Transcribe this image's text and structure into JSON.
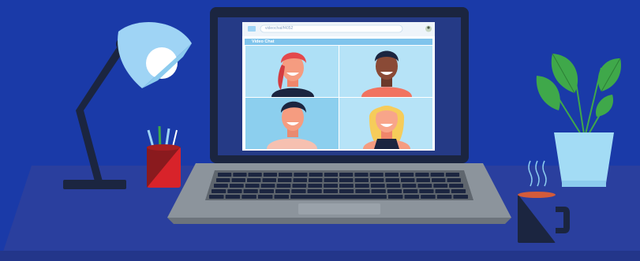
{
  "browser": {
    "url": "videochat/f4052"
  },
  "video_chat": {
    "title": "Video Chat",
    "participants": [
      {
        "label": "participant-red-ponytail"
      },
      {
        "label": "participant-dark-hair"
      },
      {
        "label": "participant-brown-hair"
      },
      {
        "label": "participant-blonde"
      }
    ]
  },
  "colors": {
    "background": "#1a3aa8",
    "desk": "#2a3f9e",
    "lamp_shade": "#9fd4f5",
    "laptop_frame": "#1b2540",
    "screen_bg": "#aee0f6",
    "pencil_cup_red": "#d8232a",
    "plant_pot": "#a3dcf5",
    "leaf_green": "#3fa84a",
    "mug": "#1b2540"
  }
}
